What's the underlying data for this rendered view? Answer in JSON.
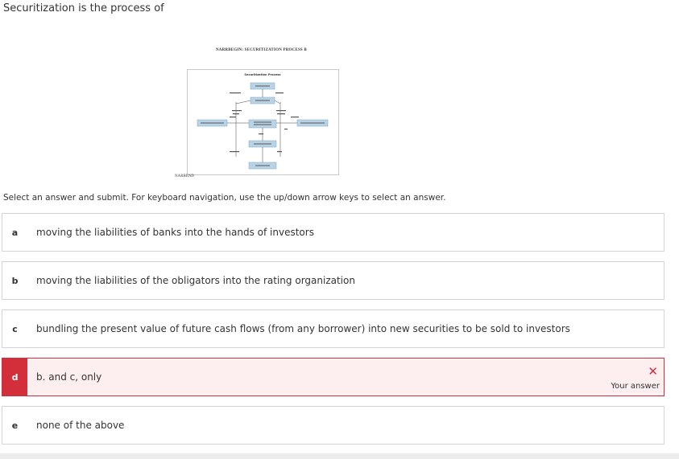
{
  "question": {
    "text": "Securitization is the process of"
  },
  "figure": {
    "caption_top": "NARRBEGIN: SECURITIZATION PROCESS B",
    "caption_bottom": "NARREND",
    "diagram_title": "Securitization Process"
  },
  "instruction": "Select an answer and submit. For keyboard navigation, use the up/down arrow keys to select an answer.",
  "options": [
    {
      "letter": "a",
      "text": "moving the liabilities of banks into the hands of investors",
      "state": "default"
    },
    {
      "letter": "b",
      "text": "moving the liabilities of the obligators into the rating organization",
      "state": "default"
    },
    {
      "letter": "c",
      "text": "bundling the present value of future cash flows (from any borrower) into new securities to be sold to investors",
      "state": "default"
    },
    {
      "letter": "d",
      "text": "b. and c, only",
      "state": "incorrect",
      "mark_icon": "x-icon",
      "note": "Your answer"
    },
    {
      "letter": "e",
      "text": "none of the above",
      "state": "default"
    }
  ],
  "colors": {
    "incorrect": "#d32f3a",
    "incorrect_bg": "#fdeef0",
    "diagram_box": "#b9d3e6"
  }
}
